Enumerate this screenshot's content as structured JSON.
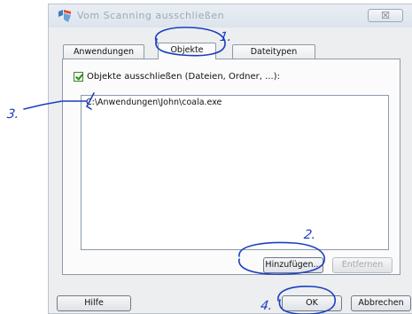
{
  "window": {
    "title": "Vom Scanning ausschließen",
    "close_label": "☒"
  },
  "tabs": [
    {
      "label": "Anwendungen",
      "active": false
    },
    {
      "label": "Objekte",
      "active": true
    },
    {
      "label": "Dateitypen",
      "active": false
    }
  ],
  "objects_tab": {
    "checkbox_label": "Objekte ausschließen (Dateien, Ordner, ...):",
    "checkbox_checked": true,
    "items": [
      "C:\\Anwendungen\\John\\coala.exe"
    ],
    "add_button": "Hinzufügen...",
    "remove_button": "Entfernen"
  },
  "footer": {
    "help_button": "Hilfe",
    "ok_button": "OK",
    "cancel_button": "Abbrechen"
  },
  "annotations": {
    "labels": [
      "1.",
      "2.",
      "3.",
      "4."
    ],
    "color": "#1b3fbf"
  }
}
